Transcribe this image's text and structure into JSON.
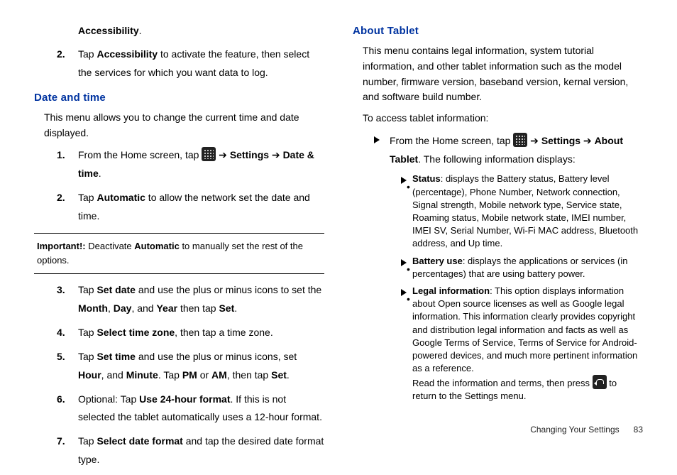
{
  "left": {
    "accessibility_bold": "Accessibility",
    "accessibility_dot": ".",
    "step2_pre": "Tap ",
    "step2_bold": "Accessibility",
    "step2_post": " to activate the feature, then select the services for which you want data to log.",
    "heading_date": "Date and time",
    "date_intro": "This menu allows you to change the current time and date displayed.",
    "d1_pre": "From the Home screen, tap ",
    "d1_arrow": " ➔ ",
    "d1_b1": "Settings",
    "d1_b2": "Date & time",
    "d1_dot": ".",
    "d2_pre": "Tap ",
    "d2_bold": "Automatic",
    "d2_post": " to allow the network set the date and time.",
    "important_label": "Important!: ",
    "important_pre": "Deactivate ",
    "important_bold": "Automatic",
    "important_post": " to manually set the rest of the options.",
    "d3_pre": "Tap ",
    "d3_b1": "Set date",
    "d3_mid1": " and use the plus or minus icons to set the ",
    "d3_b2": "Month",
    "d3_mid2": ", ",
    "d3_b3": "Day",
    "d3_mid3": ", and ",
    "d3_b4": "Year",
    "d3_mid4": " then tap ",
    "d3_b5": "Set",
    "d3_dot": ".",
    "d4_pre": "Tap ",
    "d4_b1": "Select time zone",
    "d4_post": ", then tap a time zone.",
    "d5_pre": "Tap ",
    "d5_b1": "Set time",
    "d5_mid1": " and use the plus or minus icons, set ",
    "d5_b2": "Hour",
    "d5_mid2": ", and ",
    "d5_b3": "Minute",
    "d5_mid3": ". Tap ",
    "d5_b4": "PM",
    "d5_mid4": " or ",
    "d5_b5": "AM",
    "d5_mid5": ", then tap ",
    "d5_b6": "Set",
    "d5_dot": ".",
    "d6_pre": "Optional: Tap ",
    "d6_b1": "Use 24-hour format",
    "d6_post": ". If this is not selected the tablet automatically uses a 12-hour format.",
    "d7_pre": "Tap ",
    "d7_b1": "Select date format",
    "d7_post": " and tap the desired date format type."
  },
  "right": {
    "heading_about": "About Tablet",
    "about_intro": "This menu contains legal information, system tutorial information, and other tablet information such as the model number, firmware version, baseband version, kernal version, and software build number.",
    "access_line": "To access tablet information:",
    "a1_pre": "From the Home screen, tap ",
    "a1_arrow": " ➔ ",
    "a1_b1": "Settings",
    "a1_b2": "About Tablet",
    "a1_post": ". The following information displays:",
    "bul1_b": "Status",
    "bul1_t": ": displays the Battery status, Battery level (percentage), Phone Number, Network connection, Signal strength, Mobile network type, Service state, Roaming status, Mobile network state, IMEI number, IMEI SV, Serial Number, Wi-Fi MAC address, Bluetooth address, and Up time.",
    "bul2_b": "Battery use",
    "bul2_t": ": displays the applications or services (in percentages) that are using battery power.",
    "bul3_b": "Legal information",
    "bul3_t1": ": This option displays information about Open source licenses as well as Google legal information. This information clearly provides copyright and distribution legal information and facts as well as Google Terms of Service, Terms of Service for Android-powered devices, and much more pertinent information as a reference.",
    "bul3_t2a": "Read the information and terms, then press ",
    "bul3_t2b": " to return to the Settings menu."
  },
  "footer": {
    "chapter": "Changing Your Settings",
    "page": "83"
  },
  "nums": {
    "n1": "1.",
    "n2": "2.",
    "n3": "3.",
    "n4": "4.",
    "n5": "5.",
    "n6": "6.",
    "n7": "7."
  }
}
